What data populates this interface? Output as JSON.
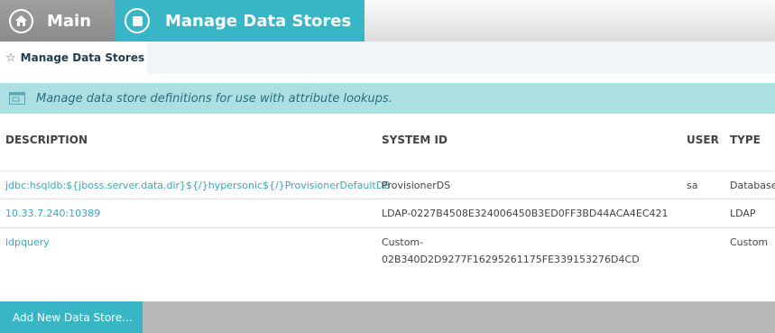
{
  "nav": {
    "main_label": "Main",
    "manage_label": "Manage Data Stores"
  },
  "breadcrumb": {
    "label": "Manage Data Stores"
  },
  "banner": {
    "text": "Manage data store definitions for use with attribute lookups."
  },
  "table": {
    "headers": {
      "description": "DESCRIPTION",
      "system_id": "SYSTEM ID",
      "user": "USER",
      "type": "TYPE"
    },
    "rows": [
      {
        "description": "jdbc:hsqldb:${jboss.server.data.dir}${/}hypersonic${/}ProvisionerDefaultDB",
        "system_id": "ProvisionerDS",
        "user": "sa",
        "type": "Database"
      },
      {
        "description": "10.33.7.240:10389",
        "system_id": "LDAP-0227B4508E324006450B3ED0FF3BD44ACA4EC421",
        "user": "",
        "type": "LDAP"
      },
      {
        "description": "idpquery",
        "system_id_line1": "Custom-",
        "system_id_line2": "02B340D2D9277F16295261175FE339153276D4CD",
        "user": "",
        "type": "Custom"
      }
    ]
  },
  "actions": {
    "add_label": "Add New Data Store..."
  },
  "colors": {
    "accent": "#39b6c6",
    "banner_bg": "#abdfe1",
    "link": "#3ca6be"
  }
}
